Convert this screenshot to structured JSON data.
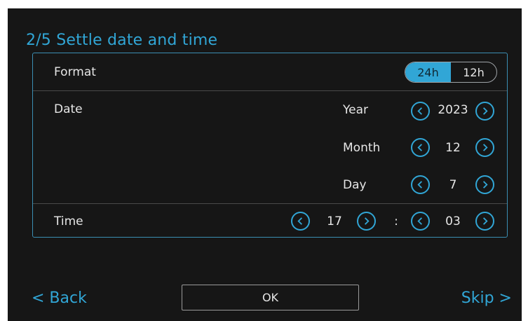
{
  "title": "2/5 Settle date and time",
  "format": {
    "label": "Format",
    "options": [
      "24h",
      "12h"
    ],
    "selected": "24h"
  },
  "date": {
    "label": "Date",
    "year": {
      "label": "Year",
      "value": "2023"
    },
    "month": {
      "label": "Month",
      "value": "12"
    },
    "day": {
      "label": "Day",
      "value": "7"
    }
  },
  "time": {
    "label": "Time",
    "hour": "17",
    "separator": ":",
    "minute": "03"
  },
  "footer": {
    "back_label": "< Back",
    "ok_label": "OK",
    "skip_label": "Skip >"
  },
  "colors": {
    "accent": "#31a6d6",
    "background": "#161616",
    "text": "#e6e6e6"
  },
  "icons": {
    "decrement": "chevron-left-circle-icon",
    "increment": "chevron-right-circle-icon"
  }
}
